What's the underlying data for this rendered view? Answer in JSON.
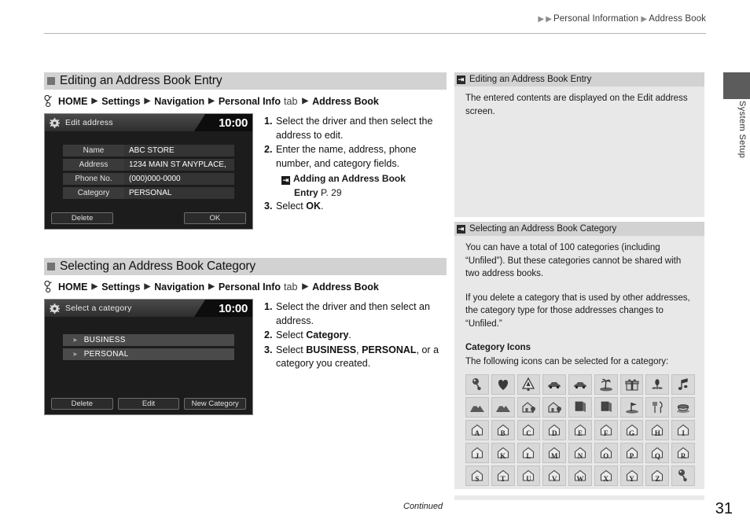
{
  "header": {
    "breadcrumb": [
      "Personal Information",
      "Address Book"
    ],
    "side_tab_label": "System Setup"
  },
  "footer": {
    "continued": "Continued",
    "page_number": "31"
  },
  "sections": [
    {
      "title": "Editing an Address Book Entry",
      "nav_path": [
        "HOME",
        "Settings",
        "Navigation",
        "Personal Info",
        "Address Book"
      ],
      "nav_tab_word": "tab",
      "screen": {
        "title": "Edit address",
        "clock": "10:00",
        "fields": [
          {
            "label": "Name",
            "value": "ABC STORE"
          },
          {
            "label": "Address",
            "value": "1234 MAIN ST ANYPLACE,"
          },
          {
            "label": "Phone No.",
            "value": "(000)000-0000"
          },
          {
            "label": "Category",
            "value": "PERSONAL"
          }
        ],
        "buttons": [
          "Delete",
          "OK"
        ]
      },
      "steps": [
        {
          "num": "1.",
          "text": "Select the driver and then select the address to edit."
        },
        {
          "num": "2.",
          "text": "Enter the name, address, phone number, and category fields.",
          "ref": {
            "title": "Adding an Address Book",
            "title2": "Entry",
            "page": "P. 29"
          }
        },
        {
          "num": "3.",
          "pre": "Select ",
          "bold": "OK",
          "post": "."
        }
      ]
    },
    {
      "title": "Selecting an Address Book Category",
      "nav_path": [
        "HOME",
        "Settings",
        "Navigation",
        "Personal Info",
        "Address Book"
      ],
      "nav_tab_word": "tab",
      "screen": {
        "title": "Select a category",
        "clock": "10:00",
        "list": [
          "BUSINESS",
          "PERSONAL"
        ],
        "buttons": [
          "Delete",
          "Edit",
          "New Category"
        ]
      },
      "steps": [
        {
          "num": "1.",
          "text": "Select the driver and then select an address."
        },
        {
          "num": "2.",
          "pre": "Select ",
          "bold": "Category",
          "post": "."
        },
        {
          "num": "3.",
          "pre": "Select ",
          "bold": "BUSINESS",
          "mid": ", ",
          "bold2": "PERSONAL",
          "post": ", or a category you created."
        }
      ]
    }
  ],
  "notes": [
    {
      "heading": "Editing an Address Book Entry",
      "paragraphs": [
        "The entered contents are displayed on the Edit address screen."
      ]
    },
    {
      "heading": "Selecting an Address Book Category",
      "paragraphs": [
        "You can have a total of 100 categories (including “Unfiled”). But these categories cannot be shared with two address books.",
        "If you delete a category that is used by other addresses, the category type for those addresses changes to “Unfiled.”"
      ],
      "subheading": "Category Icons",
      "sub_text": "The following icons can be selected for a category:",
      "icons": [
        "balloon-icon",
        "heart-icon",
        "tree-icon",
        "car-icon",
        "car2-icon",
        "palm-island-icon",
        "gift-icon",
        "flower-icon",
        "music-note-icon",
        "mountain-icon",
        "mountain2-icon",
        "house-tree-icon",
        "house-tree2-icon",
        "books-icon",
        "books2-icon",
        "golf-flag-icon",
        "restaurant-icon",
        "coffee-cup-icon",
        "house-a-icon",
        "house-b-icon",
        "house-c-icon",
        "house-d-icon",
        "house-e-icon",
        "house-f-icon",
        "house-g-icon",
        "house-h-icon",
        "house-i-icon",
        "house-j-icon",
        "house-k-icon",
        "house-l-icon",
        "house-m-icon",
        "house-n-icon",
        "house-o-icon",
        "house-p-icon",
        "house-q-icon",
        "house-r-icon",
        "house-s-icon",
        "house-t-icon",
        "house-u-icon",
        "house-v-icon",
        "house-w-icon",
        "house-x-icon",
        "house-y-icon",
        "house-z-icon",
        "balloon2-icon"
      ],
      "icon_letters": [
        "A",
        "B",
        "C",
        "D",
        "E",
        "F",
        "G",
        "H",
        "I",
        "J",
        "K",
        "L",
        "M",
        "N",
        "O",
        "P",
        "Q",
        "R",
        "S",
        "T",
        "U",
        "V",
        "W",
        "X",
        "Y",
        "Z"
      ]
    }
  ],
  "colors": {
    "section_bar": "#d2d2d2",
    "note_body": "#e8e8e8",
    "device_bg": "#1c1c1c",
    "side_tab": "#5c5c5c"
  }
}
